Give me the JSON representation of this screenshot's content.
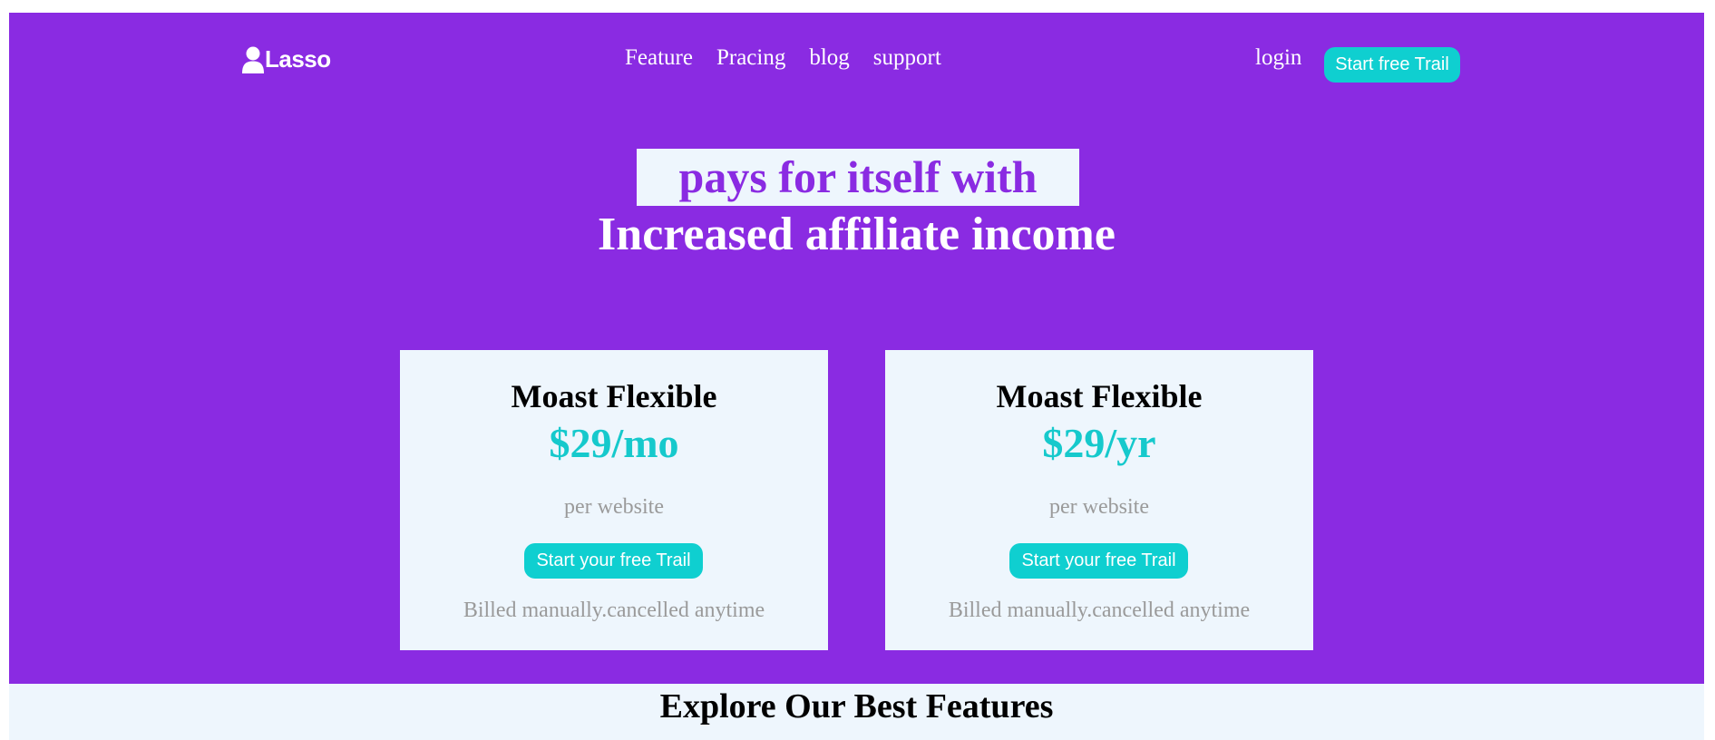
{
  "header": {
    "logo_text": "Lasso",
    "nav": [
      "Feature",
      "Pracing",
      "blog",
      "support"
    ],
    "login_label": "login",
    "start_trial_label": "Start free Trail"
  },
  "hero": {
    "headline_line1": "pays for itself with",
    "headline_line2": "Increased affiliate income"
  },
  "pricing": [
    {
      "title": "Moast Flexible",
      "price": "$29/mo",
      "subtitle": "per website",
      "button_label": "Start your free Trail",
      "note": "Billed manually.cancelled anytime"
    },
    {
      "title": "Moast Flexible",
      "price": "$29/yr",
      "subtitle": "per website",
      "button_label": "Start your free Trail",
      "note": "Billed manually.cancelled anytime"
    }
  ],
  "features": {
    "title": "Explore Our Best Features"
  },
  "colors": {
    "brand_purple": "#8a2be2",
    "accent_teal": "#0fcfd0",
    "card_bg": "#eef6fd"
  },
  "icons": {
    "logo": "user-icon"
  }
}
